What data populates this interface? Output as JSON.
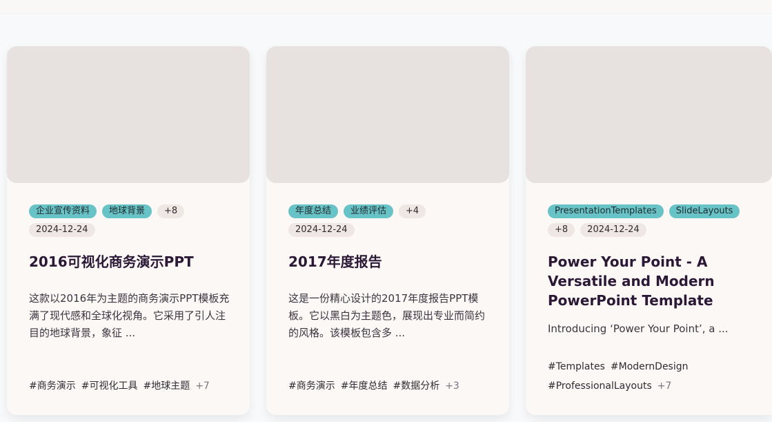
{
  "cards": [
    {
      "tags": [
        "企业宣传资料",
        "地球背景"
      ],
      "more_tags": "+8",
      "date": "2024-12-24",
      "title": "2016可视化商务演示PPT",
      "description": "这款以2016年为主题的商务演示PPT模板充满了现代感和全球化视角。它采用了引人注目的地球背景，象征 ...",
      "hashtags": [
        "#商务演示",
        "#可视化工具",
        "#地球主题"
      ],
      "more_hashtags": "+7"
    },
    {
      "tags": [
        "年度总结",
        "业绩评估"
      ],
      "more_tags": "+4",
      "date": "2024-12-24",
      "title": "2017年度报告",
      "description": "这是一份精心设计的2017年度报告PPT模板。它以黑白为主题色，展现出专业而简约的风格。该模板包含多 ...",
      "hashtags": [
        "#商务演示",
        "#年度总结",
        "#数据分析"
      ],
      "more_hashtags": "+3"
    },
    {
      "tags": [
        "PresentationTemplates",
        "SlideLayouts"
      ],
      "more_tags": "+8",
      "date": "2024-12-24",
      "title": "Power Your Point - A Versatile and Modern PowerPoint Template",
      "description": "Introducing ‘Power Your Point’, a ...",
      "hashtags": [
        "#Templates",
        "#ModernDesign",
        "#ProfessionalLayouts"
      ],
      "more_hashtags": "+7"
    }
  ],
  "colors": {
    "tag_teal": "#68c3c7",
    "tag_soft": "#efe7e3",
    "thumb": "#e7e1df",
    "card_bg": "#fcf8f5",
    "title": "#2a1836"
  }
}
